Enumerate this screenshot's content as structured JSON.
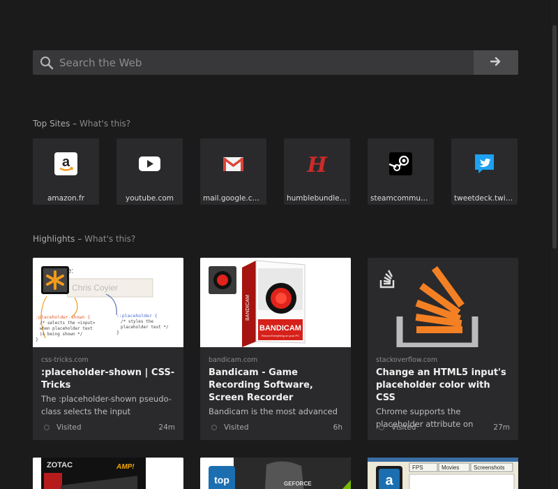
{
  "search": {
    "placeholder": "Search the Web"
  },
  "top_sites": {
    "heading": "Top Sites",
    "sep": " – ",
    "help": "What's this?",
    "items": [
      {
        "label": "amazon.fr",
        "icon": "amazon-icon"
      },
      {
        "label": "youtube.com",
        "icon": "youtube-icon"
      },
      {
        "label": "mail.google.com",
        "icon": "gmail-icon"
      },
      {
        "label": "humblebundle.c...",
        "icon": "humblebundle-icon"
      },
      {
        "label": "steamcommunit...",
        "icon": "steam-icon"
      },
      {
        "label": "tweetdeck.twitt...",
        "icon": "twitter-icon"
      }
    ]
  },
  "highlights": {
    "heading": "Highlights",
    "sep": " – ",
    "help": "What's this?",
    "cards": [
      {
        "host": "css-tricks.com",
        "title": ":placeholder-shown | CSS-Tricks",
        "desc": "The :placeholder-shown pseudo-class selects the input",
        "status": "Visited",
        "time": "24m"
      },
      {
        "host": "bandicam.com",
        "title": "Bandicam - Game Recording Software, Screen Recorder",
        "desc": "Bandicam is the most advanced",
        "status": "Visited",
        "time": "6h"
      },
      {
        "host": "stackoverflow.com",
        "title": "Change an HTML5 input's placeholder color with CSS",
        "desc": "Chrome supports the placeholder attribute on input[type=text]",
        "status": "Visited",
        "time": "27m"
      }
    ],
    "more_cards": [
      {
        "name": "zotac-card"
      },
      {
        "name": "geforce-card",
        "badge": "top"
      },
      {
        "name": "fraps-card"
      }
    ]
  },
  "thumbs": {
    "csstricks_label": "me:",
    "csstricks_field": "Chris Coyier",
    "csstricks_code_left": ":placeholder-shown {",
    "csstricks_code_right": "::placeholder {",
    "bandicam_box": "BANDICAM",
    "bandicam_sub": "Record Everything on your PC",
    "zotac": "ZOTAC",
    "amp": "AMP!",
    "geforce": "GEFORCE",
    "fraps_tab1": "FPS",
    "fraps_tab2": "Movies",
    "fraps_tab3": "Screenshots"
  },
  "colors": {
    "bg": "#1b1b1c",
    "tile": "#2a2a2c",
    "search": "#38383a",
    "stackoverflow": "#f48024",
    "bandicam_red": "#e0231b"
  }
}
